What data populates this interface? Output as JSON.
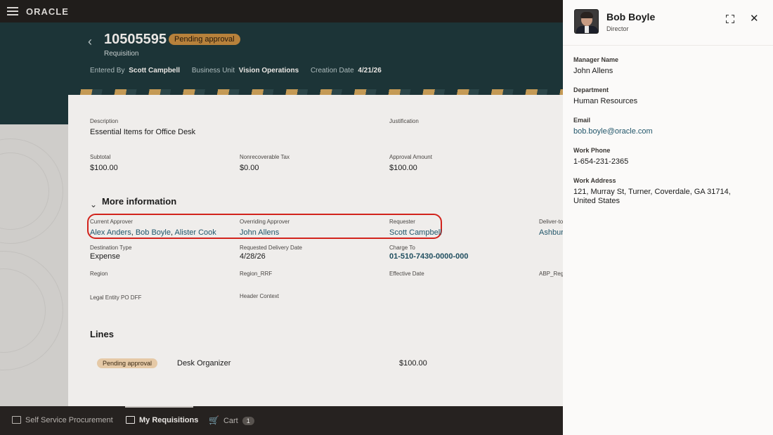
{
  "app": {
    "logo": "ORACLE"
  },
  "header": {
    "requisition_number": "10505595",
    "status": "Pending approval",
    "type": "Requisition",
    "meta": [
      {
        "label": "Entered By",
        "value": "Scott Campbell"
      },
      {
        "label": "Business Unit",
        "value": "Vision Operations"
      },
      {
        "label": "Creation Date",
        "value": "4/21/26"
      }
    ]
  },
  "summary": {
    "description": {
      "label": "Description",
      "value": "Essential Items for Office Desk"
    },
    "justification": {
      "label": "Justification",
      "value": ""
    },
    "subtotal": {
      "label": "Subtotal",
      "value": "$100.00"
    },
    "tax": {
      "label": "Nonrecoverable Tax",
      "value": "$0.00"
    },
    "approval_amount": {
      "label": "Approval Amount",
      "value": "$100.00"
    }
  },
  "more_info": {
    "title": "More information",
    "current_approver": {
      "label": "Current Approver",
      "names": [
        "Alex Anders",
        "Bob Boyle",
        "Alister Cook"
      ],
      "sep": ", "
    },
    "overriding_approver": {
      "label": "Overriding Approver",
      "value": "John Allens"
    },
    "requester": {
      "label": "Requester",
      "value": "Scott Campbell"
    },
    "deliver_to": {
      "label": "Deliver-to",
      "value": "Ashbur"
    },
    "destination_type": {
      "label": "Destination Type",
      "value": "Expense"
    },
    "requested_delivery_date": {
      "label": "Requested Delivery Date",
      "value": "4/28/26"
    },
    "charge_to": {
      "label": "Charge To",
      "value": "01-510-7430-0000-000"
    },
    "region": {
      "label": "Region"
    },
    "region_rrf": {
      "label": "Region_RRF"
    },
    "effective_date": {
      "label": "Effective Date"
    },
    "abp_region": {
      "label": "ABP_Regi"
    },
    "legal_entity": {
      "label": "Legal Entity PO DFF"
    },
    "header_context": {
      "label": "Header Context"
    }
  },
  "lines": {
    "title": "Lines",
    "items": [
      {
        "status": "Pending approval",
        "description": "Desk Organizer",
        "amount": "$100.00"
      }
    ]
  },
  "bottom_nav": {
    "items": [
      {
        "label": "Self Service Procurement",
        "icon": "store-icon"
      },
      {
        "label": "My Requisitions",
        "icon": "clipboard-icon"
      },
      {
        "label": "Cart",
        "icon": "cart-icon",
        "count": "1"
      }
    ]
  },
  "person_panel": {
    "name": "Bob Boyle",
    "title": "Director",
    "fields": [
      {
        "label": "Manager Name",
        "value": "John Allens"
      },
      {
        "label": "Department",
        "value": "Human Resources"
      },
      {
        "label": "Email",
        "value": "bob.boyle@oracle.com"
      },
      {
        "label": "Work Phone",
        "value": "1-654-231-2365"
      },
      {
        "label": "Work Address",
        "value": "121, Murray St, Turner, Coverdale, GA 31714, United States"
      }
    ]
  },
  "colors": {
    "header_bg": "#1c3437",
    "status_badge": "#b7813b",
    "link": "#22566a",
    "highlight": "#d2231c"
  }
}
